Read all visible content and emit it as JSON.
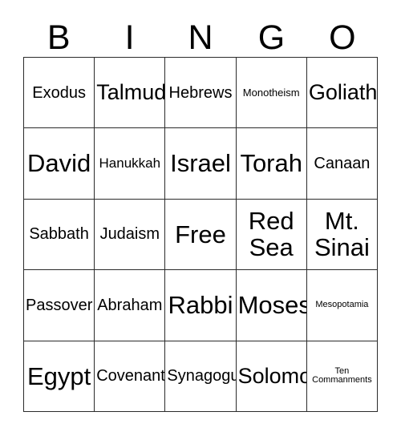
{
  "card": {
    "title_letters": [
      "B",
      "I",
      "N",
      "G",
      "O"
    ],
    "grid_line_color": "#2b2b2b",
    "background_color": "#ffffff",
    "text_color": "#000000",
    "columns": 5,
    "rows": 5,
    "free_space": "Free",
    "cells": [
      [
        {
          "text": "Exodus",
          "size": "md"
        },
        {
          "text": "Talmud",
          "size": "lg"
        },
        {
          "text": "Hebrews",
          "size": "md"
        },
        {
          "text": "Monotheism",
          "size": "xs"
        },
        {
          "text": "Goliath",
          "size": "lg"
        }
      ],
      [
        {
          "text": "David",
          "size": "xl"
        },
        {
          "text": "Hanukkah",
          "size": "sm"
        },
        {
          "text": "Israel",
          "size": "xl"
        },
        {
          "text": "Torah",
          "size": "xl"
        },
        {
          "text": "Canaan",
          "size": "md"
        }
      ],
      [
        {
          "text": "Sabbath",
          "size": "md"
        },
        {
          "text": "Judaism",
          "size": "md"
        },
        {
          "text": "Free",
          "size": "xl"
        },
        {
          "text": "Red Sea",
          "size": "xl"
        },
        {
          "text": "Mt. Sinai",
          "size": "xl"
        }
      ],
      [
        {
          "text": "Passover",
          "size": "md"
        },
        {
          "text": "Abraham",
          "size": "md"
        },
        {
          "text": "Rabbi",
          "size": "xl"
        },
        {
          "text": "Moses",
          "size": "xl"
        },
        {
          "text": "Mesopotamia",
          "size": "xxs"
        }
      ],
      [
        {
          "text": "Egypt",
          "size": "xl"
        },
        {
          "text": "Covenant",
          "size": "md"
        },
        {
          "text": "Synagogue",
          "size": "md"
        },
        {
          "text": "Solomon",
          "size": "lg"
        },
        {
          "text": "Ten Commanments",
          "size": "xxs"
        }
      ]
    ]
  }
}
